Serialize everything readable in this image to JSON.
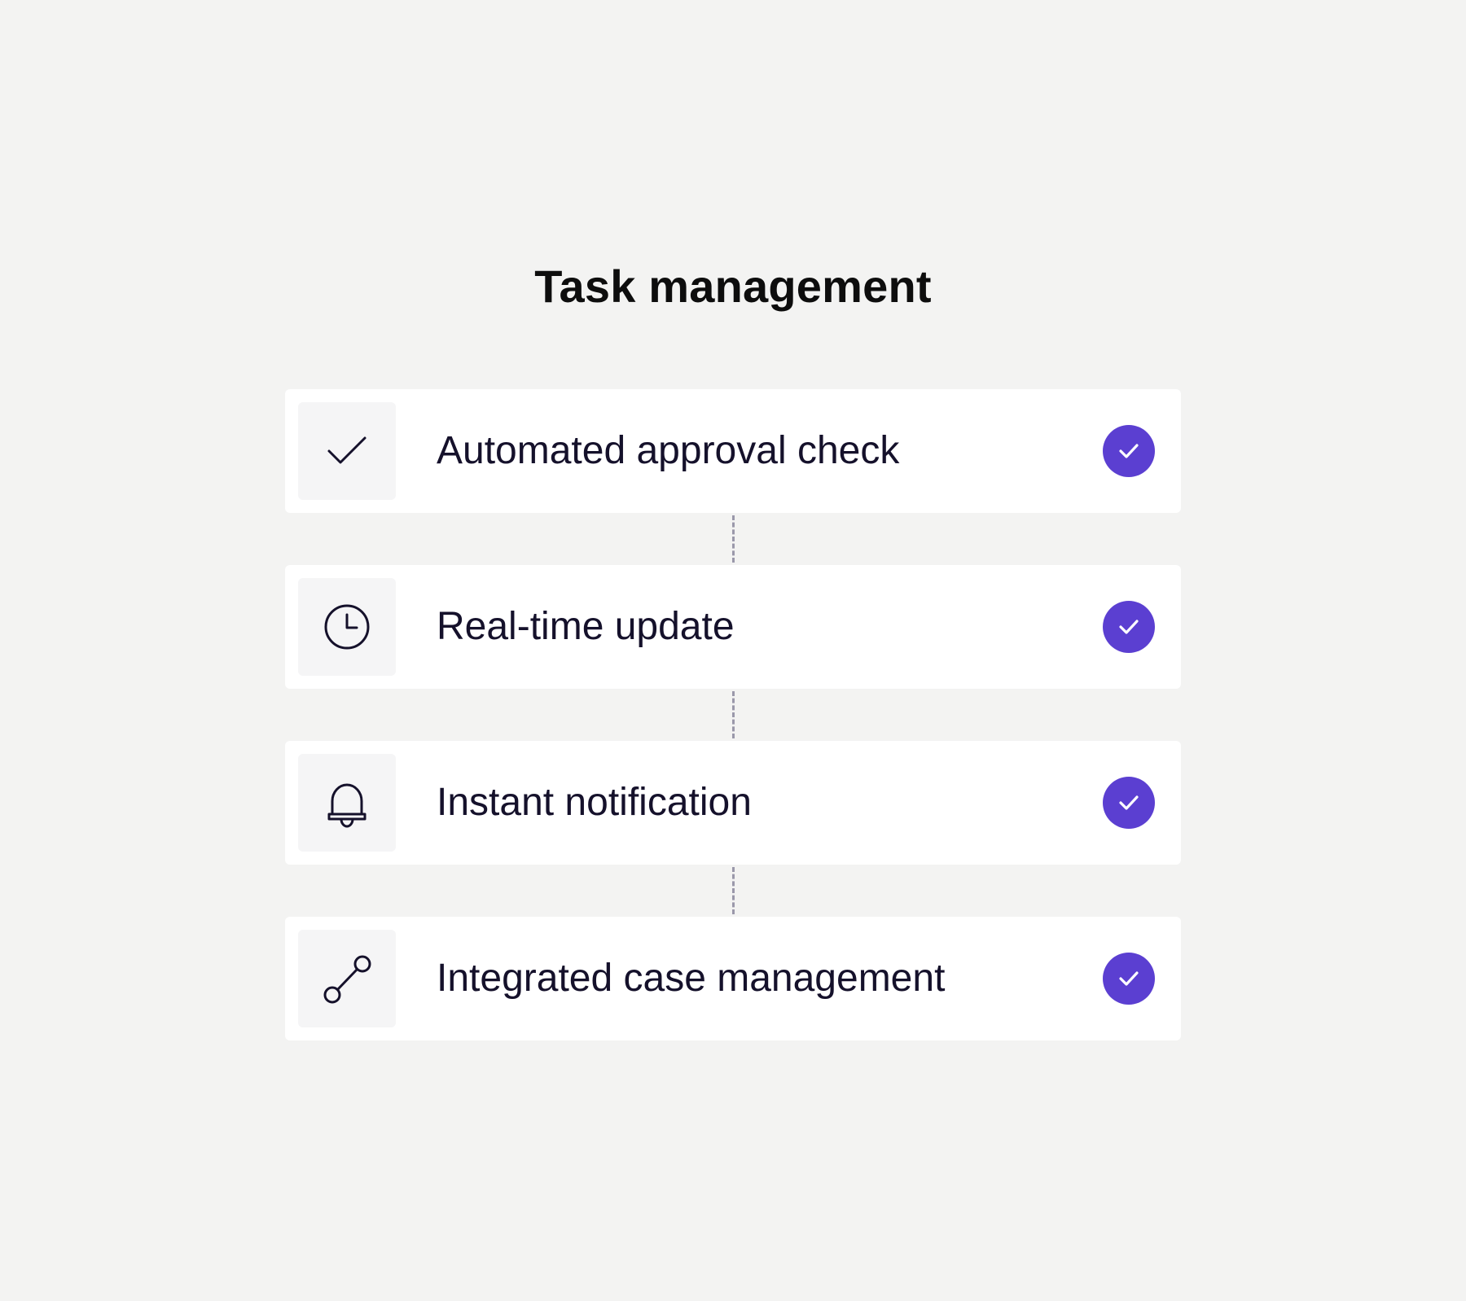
{
  "page": {
    "title": "Task management"
  },
  "colors": {
    "background": "#f3f3f2",
    "card": "#ffffff",
    "icon_box": "#f5f5f6",
    "accent": "#5b3fd1",
    "icon_stroke": "#15112b",
    "connector": "#9a98aa"
  },
  "tasks": [
    {
      "label": "Automated approval check",
      "icon": "check-icon",
      "status": "completed"
    },
    {
      "label": "Real-time update",
      "icon": "clock-icon",
      "status": "completed"
    },
    {
      "label": "Instant notification",
      "icon": "bell-icon",
      "status": "completed"
    },
    {
      "label": "Integrated case management",
      "icon": "connection-icon",
      "status": "completed"
    }
  ]
}
